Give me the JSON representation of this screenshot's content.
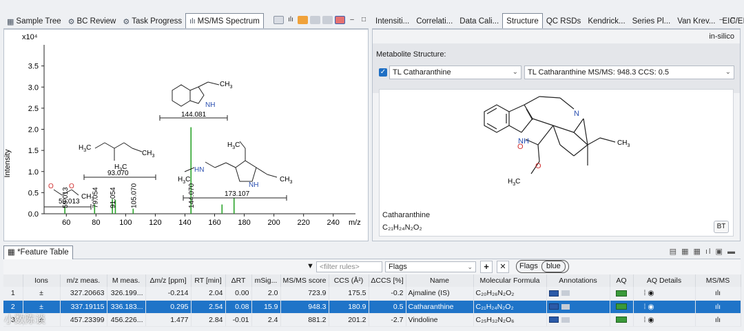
{
  "left_panel": {
    "tabs": [
      {
        "label": "Sample Tree",
        "icon": "tree-icon"
      },
      {
        "label": "BC Review",
        "icon": "review-icon"
      },
      {
        "label": "Task Progress",
        "icon": "gears-icon"
      },
      {
        "label": "MS/MS Spectrum",
        "icon": "spectrum-icon"
      }
    ],
    "toolbar_icons": [
      "layout-icon",
      "spectrum-icon",
      "orange-icon",
      "gray-icon",
      "gray-icon",
      "mirror-icon"
    ]
  },
  "chart_data": {
    "type": "bar",
    "title": "",
    "xlabel": "m/z",
    "ylabel": "Intensity",
    "y_exponent": "x10⁴",
    "xlim": [
      45,
      255
    ],
    "ylim": [
      0,
      4.0
    ],
    "x_ticks": [
      "60",
      "80",
      "100",
      "120",
      "140",
      "160",
      "180",
      "200",
      "220",
      "240"
    ],
    "y_ticks": [
      "0.0",
      "0.5",
      "1.0",
      "1.5",
      "2.0",
      "2.5",
      "3.0",
      "3.5"
    ],
    "series": [
      {
        "color": "#2aa32a",
        "x": [
          59.013,
          79.054,
          91.054,
          93.07,
          105.07,
          144.081,
          144.07,
          165,
          173.107
        ],
        "y": [
          0.18,
          0.22,
          0.35,
          0.33,
          0.12,
          2.05,
          0.12,
          0.22,
          0.38
        ]
      }
    ],
    "peak_labels": [
      "59.013",
      "79.054",
      "91.054",
      "105.070",
      "144.070"
    ],
    "fragment_masses": [
      "144.081",
      "93.070",
      "59.013",
      "173.107"
    ]
  },
  "right_panel": {
    "tabs": [
      "Intensiti...",
      "Correlati...",
      "Data Cali...",
      "Structure",
      "QC RSDs",
      "Kendrick...",
      "Series Pl...",
      "Van Krev...",
      "EIC/EIM"
    ],
    "active_tab": "Structure",
    "mode": "in-silico",
    "structure_label": "Metabolite Structure:",
    "compound_select": "TL Catharanthine",
    "msms_select": "TL Catharanthine MS/MS: 948.3 CCS: 0.5",
    "compound_name": "Catharanthine",
    "formula": "C₂₁H₂₄N₂O₂",
    "bt_button": "BT"
  },
  "feature_table": {
    "tab_label": "*Feature Table",
    "filter_placeholder": "<filter rules>",
    "flags_value": "Flags",
    "flags_chip": "Flags",
    "flags_chip_value": "blue",
    "columns": [
      "",
      "Ions",
      "m/z meas.",
      "M meas.",
      "Δm/z [ppm]",
      "RT [min]",
      "ΔRT",
      "mSig...",
      "MS/MS score",
      "CCS (Å²)",
      "ΔCCS [%]",
      "Name",
      "Molecular Formula",
      "Annotations",
      "AQ",
      "AQ Details",
      "MS/MS"
    ],
    "rows": [
      {
        "idx": "1",
        "ions": "±",
        "mz": "327.20663",
        "M": "326.199...",
        "dmz": "-0.214",
        "rt": "2.04",
        "drt": "0.00",
        "msig": "2.0",
        "score": "723.9",
        "ccs": "175.5",
        "dccs": "-0.2",
        "name": "Ajmaline (IS)",
        "formula": "C₂₀H₂₆N₂O₂",
        "selected": false
      },
      {
        "idx": "2",
        "ions": "±",
        "mz": "337.19115",
        "M": "336.183...",
        "dmz": "0.295",
        "rt": "2.54",
        "drt": "0.08",
        "msig": "15.9",
        "score": "948.3",
        "ccs": "180.9",
        "dccs": "0.5",
        "name": "Catharanthine",
        "formula": "C₂₁H₂₄N₂O₂",
        "selected": true
      },
      {
        "idx": "3",
        "ions": "±",
        "mz": "457.23399",
        "M": "456.226...",
        "dmz": "1.477",
        "rt": "2.84",
        "drt": "-0.01",
        "msig": "2.4",
        "score": "881.2",
        "ccs": "201.2",
        "dccs": "-2.7",
        "name": "Vindoline",
        "formula": "C₂₅H₃₂N₂O₆",
        "selected": false
      }
    ]
  },
  "watermark": "小数陈谈"
}
